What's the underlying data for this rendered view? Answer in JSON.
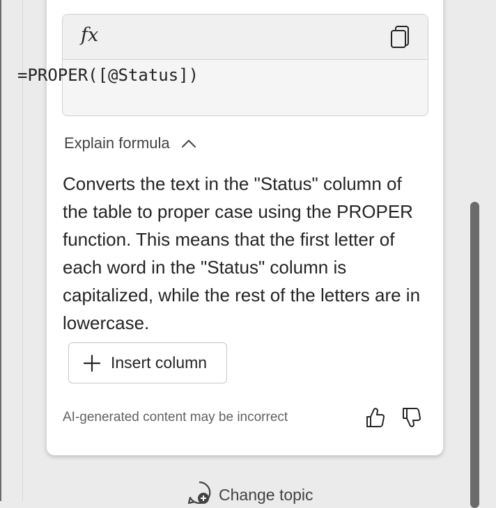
{
  "formula": {
    "fx_symbol": "fx",
    "expression": "=PROPER([@Status])",
    "copy_icon": "copy-icon"
  },
  "explain": {
    "label": "Explain formula",
    "chevron_icon": "chevron-up-icon",
    "text": "Converts the text in the \"Status\" column of the table to proper case using the PROPER function. This means that the first letter of each word in the \"Status\" column is capitalized, while the rest of the letters are in lowercase."
  },
  "insert_button": {
    "label": "Insert column",
    "icon": "plus-icon"
  },
  "footer": {
    "disclaimer": "AI-generated content may be incorrect",
    "thumbs_up_icon": "thumbs-up-icon",
    "thumbs_down_icon": "thumbs-down-icon"
  },
  "change_topic": {
    "label": "Change topic",
    "icon": "new-chat-icon"
  },
  "colors": {
    "card_bg": "#ffffff",
    "pane_bg": "#ebebeb",
    "formula_bg": "#f5f5f5",
    "scrollbar": "#6b6b6b"
  }
}
